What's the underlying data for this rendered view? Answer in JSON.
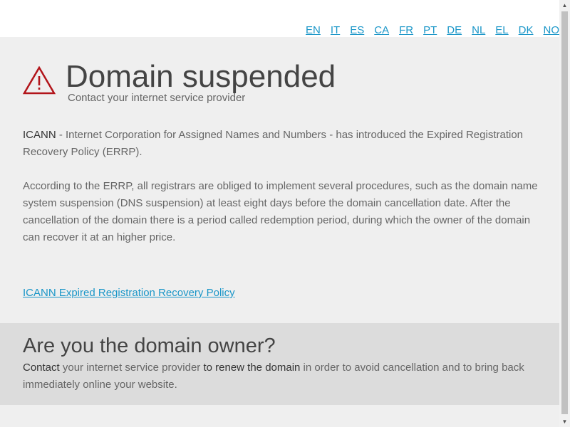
{
  "languages": [
    "EN",
    "IT",
    "ES",
    "CA",
    "FR",
    "PT",
    "DE",
    "NL",
    "EL",
    "DK",
    "NO"
  ],
  "icons": {
    "warning": "warning-triangle-icon",
    "warning_color": "#b2141a"
  },
  "header": {
    "title": "Domain suspended",
    "subtitle": "Contact your internet service provider"
  },
  "body": {
    "p1_strong": "ICANN",
    "p1_text": " - Internet Corporation for Assigned Names and Numbers - has introduced the Expired Registration Recovery Policy (ERRP).",
    "p2_text": "According to the ERRP, all registrars are obliged to implement several procedures, such as the domain name system suspension (DNS suspension) at least eight days before the domain cancellation date. After the cancellation of the domain there is a period called redemption period, during which the owner of the domain can recover it at an higher price.",
    "policy_link": "ICANN Expired Registration Recovery Policy"
  },
  "owner": {
    "title": "Are you the domain owner?",
    "contact": "Contact",
    "text1": " your internet service provider ",
    "renew": "to renew the domain",
    "text2": " in order to avoid cancellation and to bring back immediately online your website."
  },
  "colors": {
    "link": "#1a96c8",
    "panel": "#efefef",
    "owner_panel": "#dcdcdc"
  }
}
